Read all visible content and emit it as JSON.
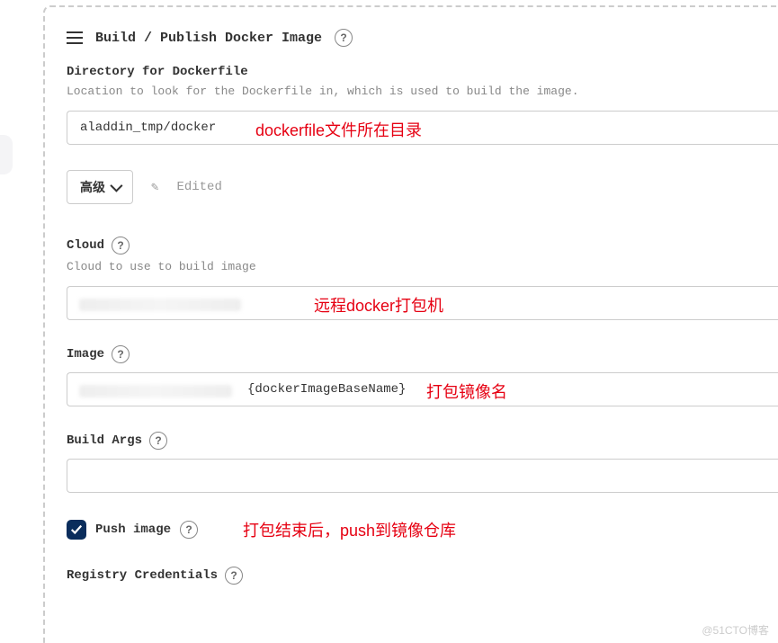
{
  "header": {
    "title": "Build / Publish Docker Image"
  },
  "directory": {
    "label": "Directory for Dockerfile",
    "desc": "Location to look for the Dockerfile in, which is used to build the image.",
    "value": "aladdin_tmp/docker",
    "annotation": "dockerfile文件所在目录"
  },
  "advanced": {
    "button_label": "高级",
    "edited_label": "Edited"
  },
  "cloud": {
    "label": "Cloud",
    "desc": "Cloud to use to build image",
    "annotation": "远程docker打包机"
  },
  "image": {
    "label": "Image",
    "value_suffix": "{dockerImageBaseName}",
    "annotation": "打包镜像名"
  },
  "build_args": {
    "label": "Build Args"
  },
  "push_image": {
    "label": "Push image",
    "checked": true,
    "annotation": "打包结束后，push到镜像仓库"
  },
  "registry": {
    "label": "Registry Credentials"
  },
  "watermark": "@51CTO博客"
}
